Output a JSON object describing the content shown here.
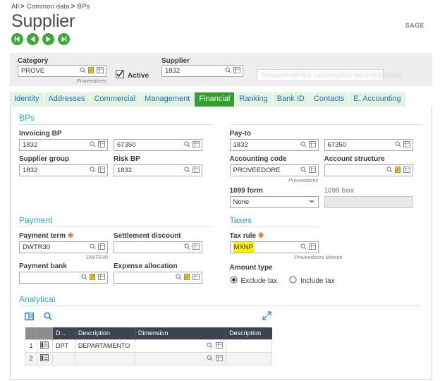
{
  "breadcrumb": {
    "items": [
      "All",
      "Common data",
      "BPs"
    ],
    "separator": ">"
  },
  "page": {
    "title": "Supplier",
    "logo": "SAGE"
  },
  "record_nav": [
    {
      "name": "first-record",
      "label": "First"
    },
    {
      "name": "previous-record",
      "label": "Previous"
    },
    {
      "name": "next-record",
      "label": "Next"
    },
    {
      "name": "last-record",
      "label": "Last"
    }
  ],
  "header": {
    "category": {
      "label": "Category",
      "value": "PROVE",
      "helper": "Proveedores"
    },
    "active": {
      "label": "Active",
      "checked": true
    },
    "supplier": {
      "label": "Supplier",
      "value": "1832"
    },
    "company_name": {
      "value": "TRANSPORTES LAGENERIA MEXTEQUANA",
      "redacted": true
    }
  },
  "tabs": [
    {
      "label": "Identity",
      "active": false
    },
    {
      "label": "Addresses",
      "active": false
    },
    {
      "label": "Commercial",
      "active": false
    },
    {
      "label": "Management",
      "active": false
    },
    {
      "label": "Financial",
      "active": true
    },
    {
      "label": "Ranking",
      "active": false
    },
    {
      "label": "Bank ID",
      "active": false
    },
    {
      "label": "Contacts",
      "active": false
    },
    {
      "label": "E. Accounting",
      "active": false
    }
  ],
  "sections": {
    "bps": {
      "title": "BPs",
      "invoicing_bp": {
        "label": "Invoicing BP",
        "value": "1832"
      },
      "invoicing_bp_2": {
        "value": "67350"
      },
      "supplier_group": {
        "label": "Supplier group",
        "value": "1832"
      },
      "risk_bp": {
        "label": "Risk BP",
        "value": "1832"
      },
      "pay_to": {
        "label": "Pay-to",
        "value": "1832"
      },
      "pay_to_2": {
        "value": "67350"
      },
      "accounting_code": {
        "label": "Accounting code",
        "value": "PROVEEDORE",
        "helper": "Proveedores"
      },
      "account_structure": {
        "label": "Account structure",
        "value": ""
      },
      "form_1099": {
        "label": "1099 form",
        "value": "None"
      },
      "box_1099": {
        "label": "1099 box",
        "value": ""
      }
    },
    "payment": {
      "title": "Payment",
      "payment_term": {
        "label": "Payment term",
        "required": true,
        "value": "DWTR30",
        "helper": "DWTR30"
      },
      "settlement_discount": {
        "label": "Settlement discount",
        "value": ""
      },
      "payment_bank": {
        "label": "Payment bank",
        "value": ""
      },
      "expense_allocation": {
        "label": "Expense allocation",
        "value": ""
      }
    },
    "taxes": {
      "title": "Taxes",
      "tax_rule": {
        "label": "Tax rule",
        "required": true,
        "value": "MXNP",
        "helper": "Proveedores Mexico",
        "highlight": "#fbf000"
      },
      "amount_type": {
        "label": "Amount type",
        "options": [
          {
            "label": "Exclude tax",
            "selected": true
          },
          {
            "label": "Include tax",
            "selected": false
          }
        ]
      }
    },
    "analytical": {
      "title": "Analytical",
      "columns": [
        "",
        "",
        "D...",
        "Description",
        "Dimension",
        "Description"
      ],
      "rows": [
        {
          "num": "1",
          "code": "DPT",
          "description": "DEPARTAMENTO",
          "dimension": "",
          "dimension_description": ""
        },
        {
          "num": "2",
          "code": "",
          "description": "",
          "dimension": "",
          "dimension_description": ""
        }
      ]
    }
  },
  "colors": {
    "accent_green": "#2fa12a",
    "section_blue": "#2aa8d8",
    "link_blue": "#1f6fb4",
    "required": "#e8762c",
    "highlight": "#fbf000"
  }
}
